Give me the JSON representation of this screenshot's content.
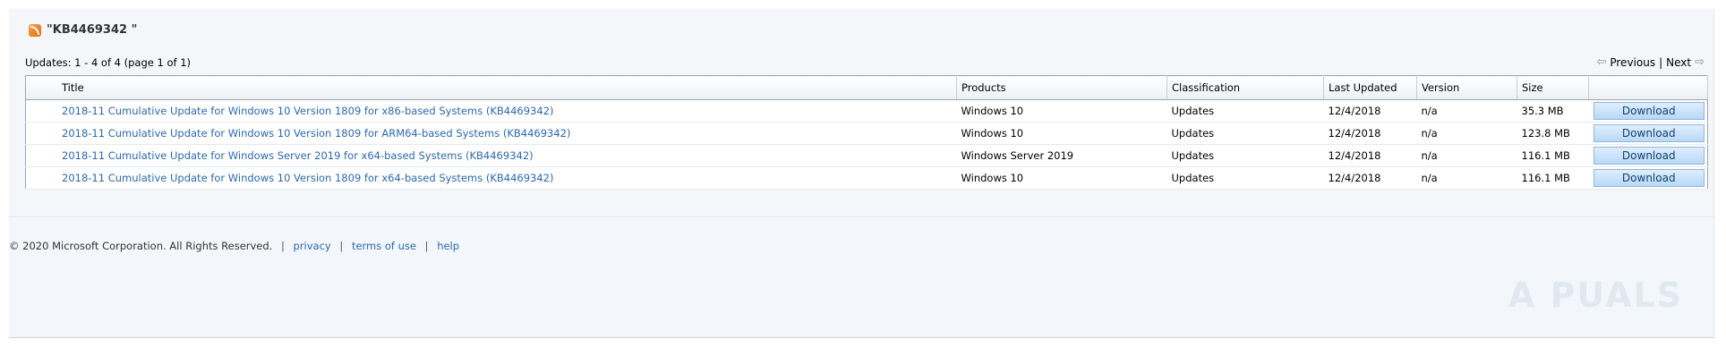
{
  "query": {
    "text": "\"KB4469342 \"",
    "icon": "rss-icon"
  },
  "updates_count": "Updates: 1 - 4 of 4 (page 1 of 1)",
  "pager": {
    "previous": "Previous",
    "separator": "|",
    "next": "Next"
  },
  "table": {
    "headers": [
      "Title",
      "Products",
      "Classification",
      "Last Updated",
      "Version",
      "Size",
      ""
    ],
    "rows": [
      {
        "title": "2018-11 Cumulative Update for Windows 10 Version 1809 for x86-based Systems (KB4469342)",
        "products": "Windows 10",
        "classification": "Updates",
        "last_updated": "12/4/2018",
        "version": "n/a",
        "size": "35.3 MB",
        "action": "Download"
      },
      {
        "title": "2018-11 Cumulative Update for Windows 10 Version 1809 for ARM64-based Systems (KB4469342)",
        "products": "Windows 10",
        "classification": "Updates",
        "last_updated": "12/4/2018",
        "version": "n/a",
        "size": "123.8 MB",
        "action": "Download"
      },
      {
        "title": "2018-11 Cumulative Update for Windows Server 2019 for x64-based Systems (KB4469342)",
        "products": "Windows Server 2019",
        "classification": "Updates",
        "last_updated": "12/4/2018",
        "version": "n/a",
        "size": "116.1 MB",
        "action": "Download"
      },
      {
        "title": "2018-11 Cumulative Update for Windows 10 Version 1809 for x64-based Systems (KB4469342)",
        "products": "Windows 10",
        "classification": "Updates",
        "last_updated": "12/4/2018",
        "version": "n/a",
        "size": "116.1 MB",
        "action": "Download"
      }
    ]
  },
  "footer": {
    "copyright": "© 2020 Microsoft Corporation. All Rights Reserved.",
    "separator": "|",
    "privacy": "privacy",
    "terms": "terms of use",
    "help": "help"
  },
  "watermark": "A  PUALS",
  "colors": {
    "link": "#2b68b1",
    "button": "#b9d8f5"
  }
}
